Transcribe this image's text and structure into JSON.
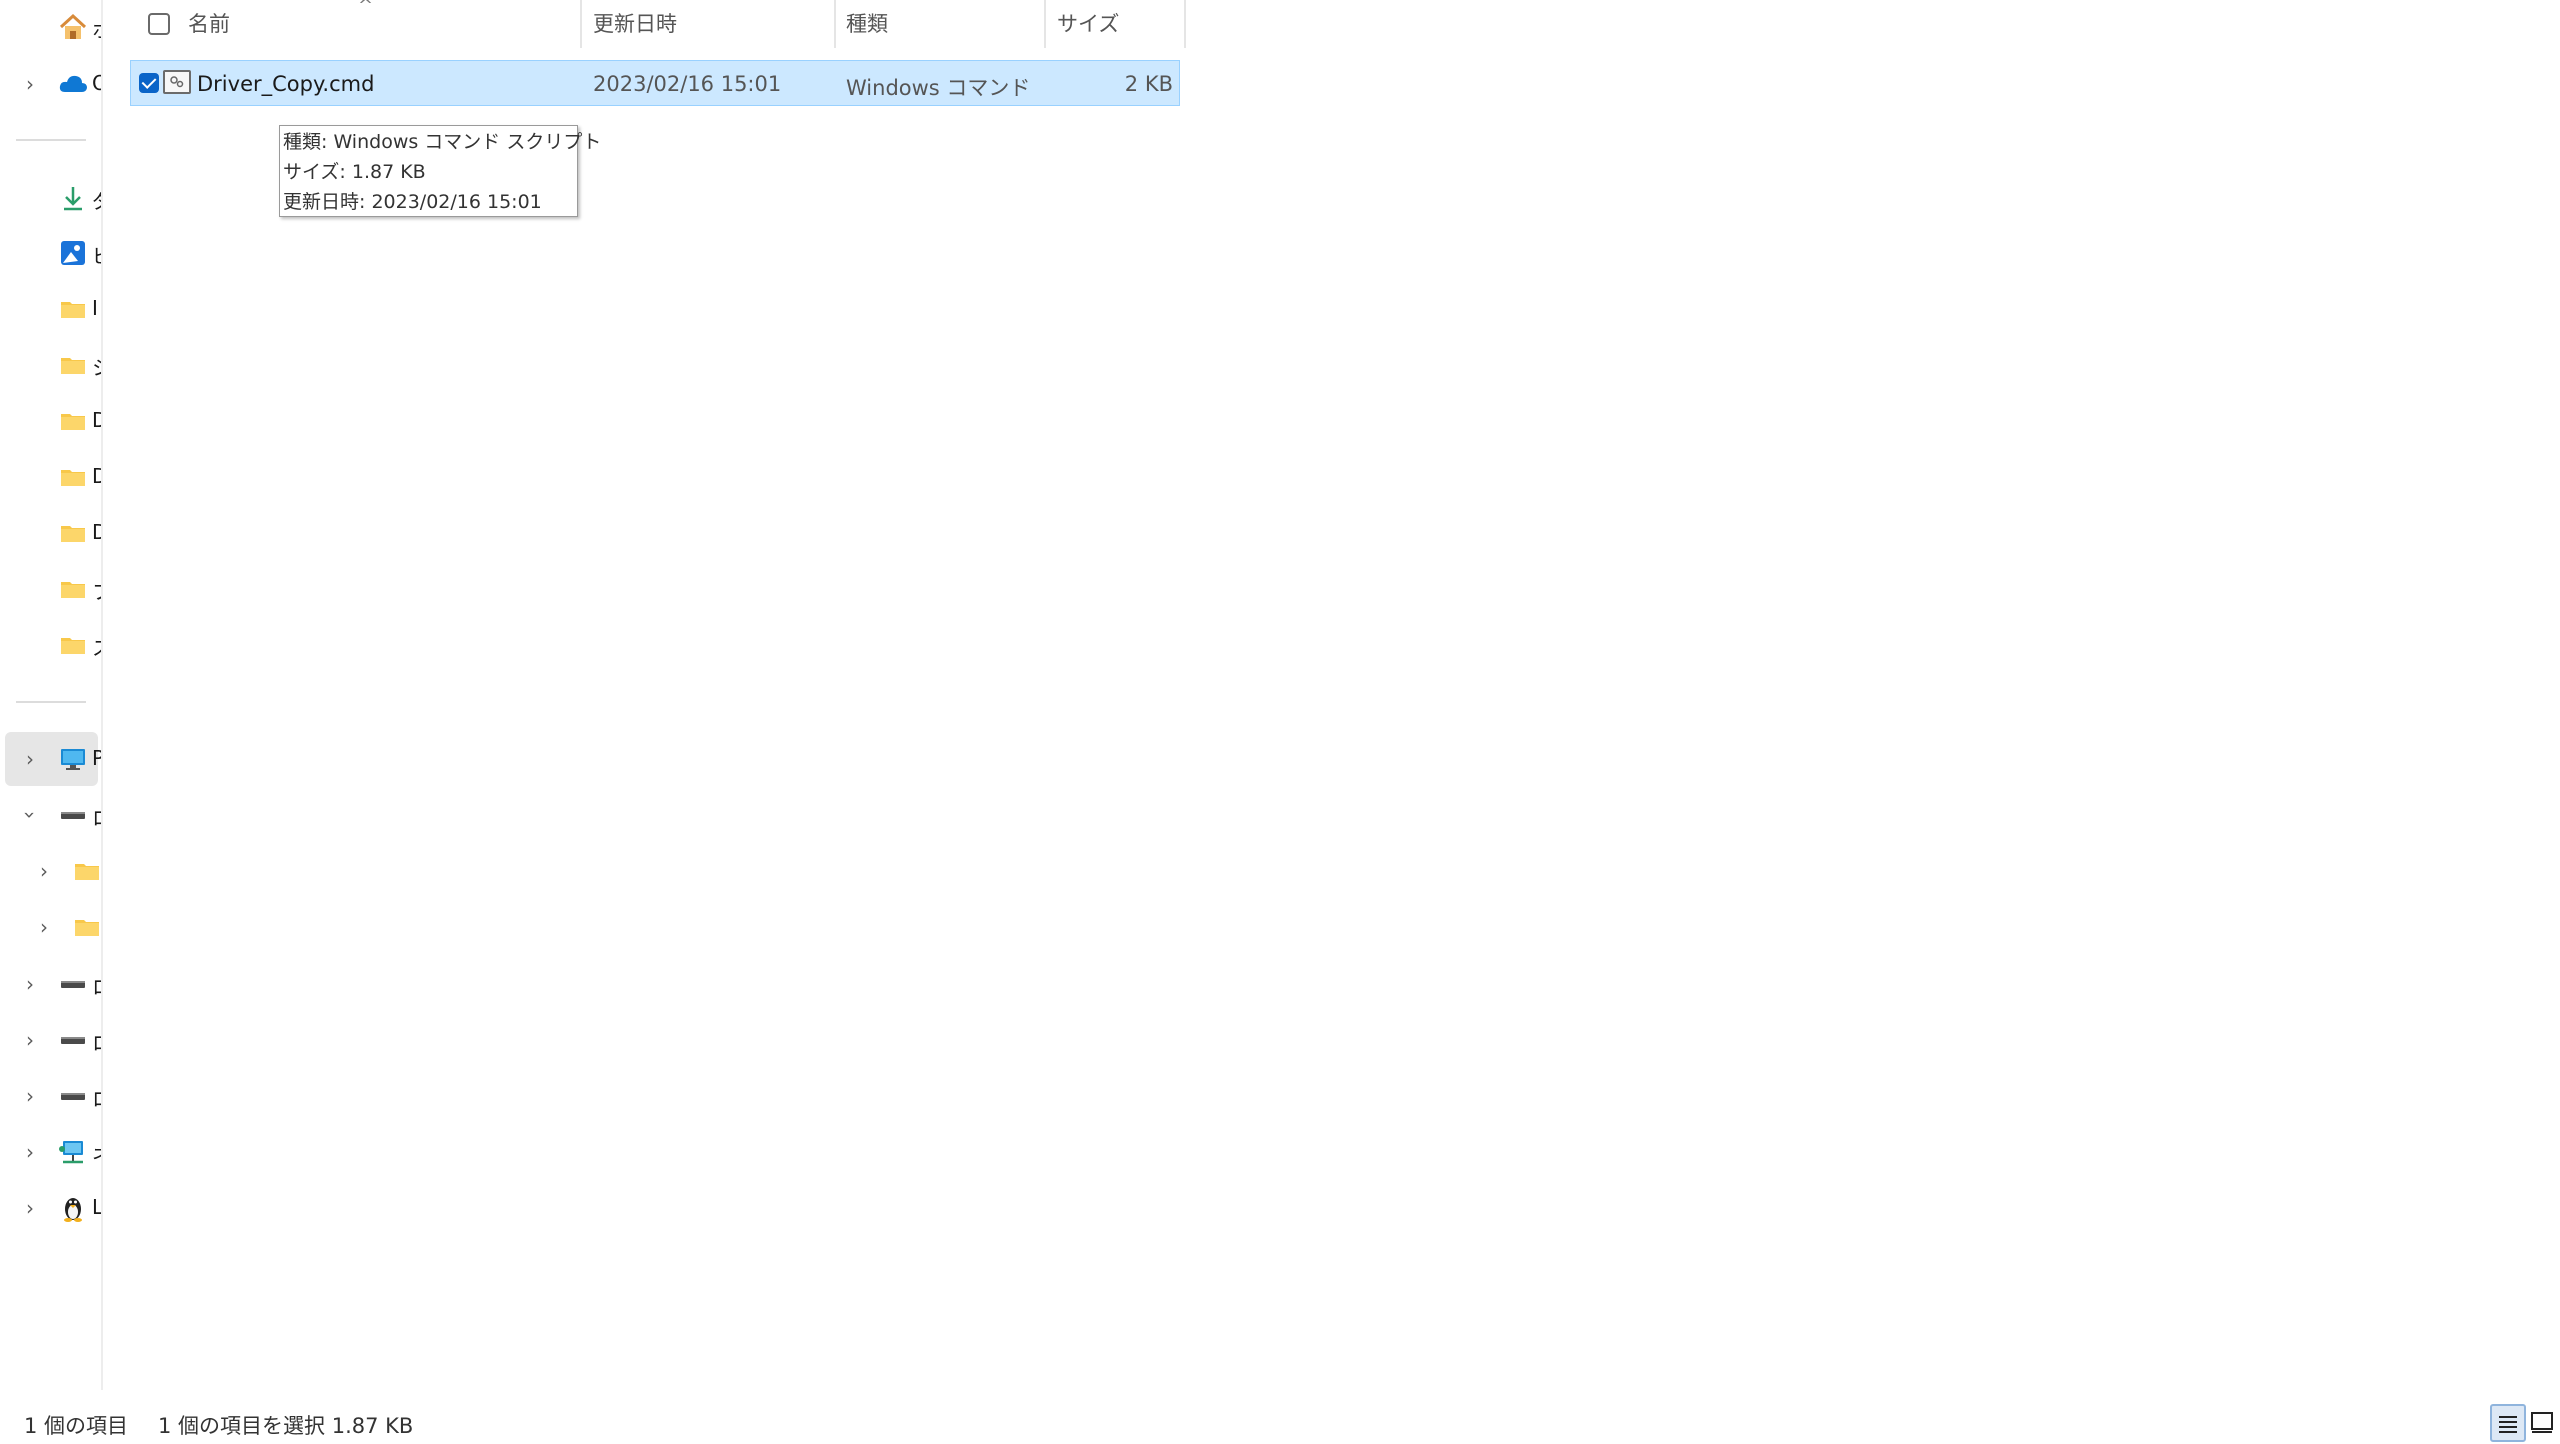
{
  "navigation": {
    "items": [
      {
        "name": "home",
        "icon": "home-icon",
        "label": "ホーム",
        "expandable": false
      },
      {
        "name": "onedrive",
        "icon": "cloud-icon",
        "label": "OneDrive",
        "expandable": true
      },
      {
        "name": "downloads",
        "icon": "download-icon",
        "label": "ダウンロード",
        "expandable": false
      },
      {
        "name": "pictures",
        "icon": "picture-icon",
        "label": "ピクチャ",
        "expandable": false
      },
      {
        "name": "folder-1",
        "icon": "folder-icon",
        "label": "I",
        "expandable": false
      },
      {
        "name": "folder-2",
        "icon": "folder-icon",
        "label": "シ",
        "expandable": false
      },
      {
        "name": "folder-3",
        "icon": "folder-icon",
        "label": "D",
        "expandable": false
      },
      {
        "name": "folder-4",
        "icon": "folder-icon",
        "label": "D",
        "expandable": false
      },
      {
        "name": "folder-5",
        "icon": "folder-icon",
        "label": "D",
        "expandable": false
      },
      {
        "name": "folder-6",
        "icon": "folder-icon",
        "label": "フ",
        "expandable": false
      },
      {
        "name": "folder-7",
        "icon": "folder-icon",
        "label": "ス",
        "expandable": false
      },
      {
        "name": "pc",
        "icon": "monitor-icon",
        "label": "PC",
        "expandable": true
      },
      {
        "name": "drive-1",
        "icon": "drive-icon",
        "label": "ロ",
        "expandable": true
      },
      {
        "name": "subfolder-1",
        "icon": "folder-icon",
        "label": "",
        "expandable": true
      },
      {
        "name": "subfolder-2",
        "icon": "folder-icon",
        "label": "",
        "expandable": true
      },
      {
        "name": "drive-2",
        "icon": "drive-icon",
        "label": "ロ",
        "expandable": true
      },
      {
        "name": "drive-3",
        "icon": "drive-icon",
        "label": "ロ",
        "expandable": true
      },
      {
        "name": "drive-4",
        "icon": "drive-icon",
        "label": "ロ",
        "expandable": true
      },
      {
        "name": "network",
        "icon": "network-icon",
        "label": "ネ",
        "expandable": true
      },
      {
        "name": "linux",
        "icon": "linux-penguin-icon",
        "label": "L",
        "expandable": true
      }
    ]
  },
  "columns": {
    "name": "名前",
    "modified": "更新日時",
    "type": "種類",
    "size": "サイズ"
  },
  "files": [
    {
      "name": "Driver_Copy.cmd",
      "modified": "2023/02/16 15:01",
      "type": "Windows コマンド ...",
      "size": "2 KB",
      "selected": true,
      "icon": "cmd-script-icon"
    }
  ],
  "tooltip": {
    "type_line": "種類: Windows コマンド スクリプト",
    "size_line": "サイズ: 1.87 KB",
    "modified_line": "更新日時: 2023/02/16 15:01"
  },
  "status_bar": {
    "item_count": "1 個の項目",
    "selection": "1 個の項目を選択  1.87 KB"
  },
  "colors": {
    "selection_bg": "#cce8ff",
    "selection_border": "#99d1ff",
    "checkbox_accent": "#0a64c8",
    "folder": "#f8c84a"
  }
}
